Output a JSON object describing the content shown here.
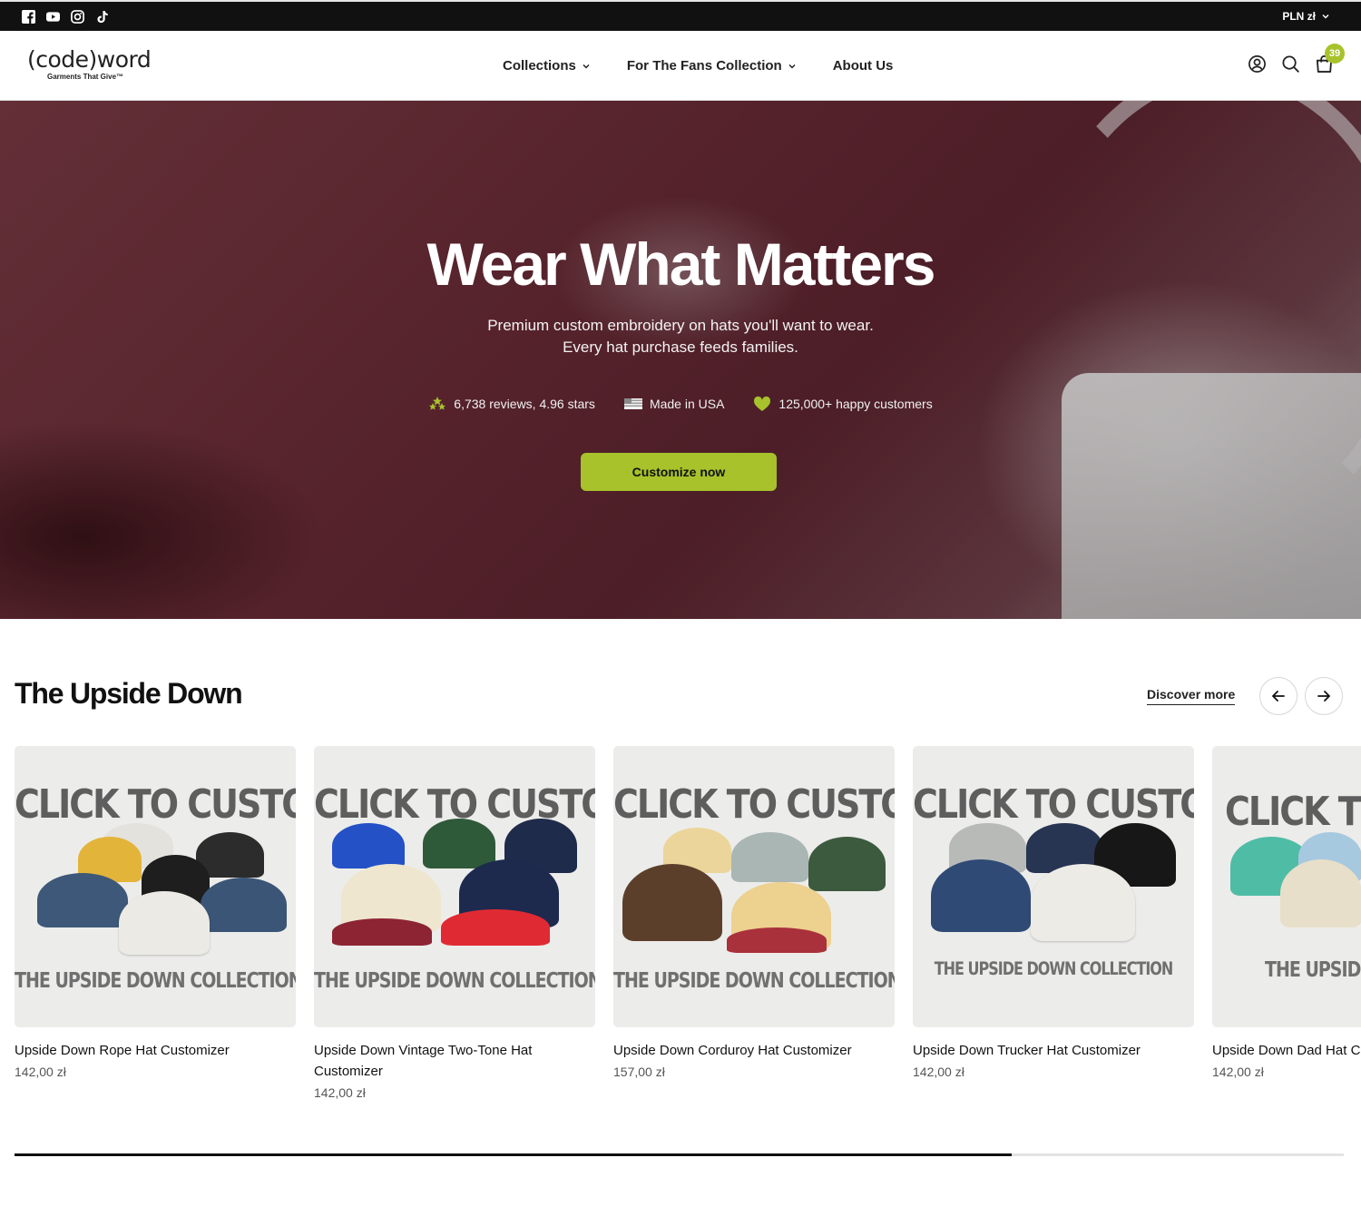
{
  "topbar": {
    "icons": [
      "facebook-icon",
      "youtube-icon",
      "instagram-icon",
      "tiktok-icon"
    ],
    "currency": "PLN zł"
  },
  "header": {
    "logo": {
      "main": "(code)word",
      "tagline": "Garments That Give™"
    },
    "nav": [
      {
        "label": "Collections",
        "dropdown": true
      },
      {
        "label": "For The Fans Collection",
        "dropdown": true
      },
      {
        "label": "About Us",
        "dropdown": false
      }
    ],
    "cart_count": "39"
  },
  "hero": {
    "title": "Wear What Matters",
    "subtitle_line1": "Premium custom embroidery on hats you'll want to wear.",
    "subtitle_line2": "Every hat purchase feeds families.",
    "badges": [
      {
        "icon": "stars-icon",
        "text": "6,738 reviews, 4.96 stars"
      },
      {
        "icon": "us-flag-icon",
        "text": "Made in USA"
      },
      {
        "icon": "heart-icon",
        "text": "125,000+ happy customers"
      }
    ],
    "cta": "Customize now"
  },
  "section": {
    "title": "The Upside Down",
    "discover": "Discover more"
  },
  "products": [
    {
      "name": "Upside Down Rope Hat Customizer",
      "price": "142,00 zł",
      "image_head": "CLICK TO CUSTOMIZE",
      "image_foot": "THE UPSIDE DOWN COLLECTION"
    },
    {
      "name": "Upside Down Vintage Two-Tone Hat Customizer",
      "price": "142,00 zł",
      "image_head": "CLICK TO CUSTOMIZE",
      "image_foot": "THE UPSIDE DOWN COLLECTION"
    },
    {
      "name": "Upside Down Corduroy Hat Customizer",
      "price": "157,00 zł",
      "image_head": "CLICK TO CUSTOMIZE",
      "image_foot": "THE UPSIDE DOWN COLLECTION"
    },
    {
      "name": "Upside Down Trucker Hat Customizer",
      "price": "142,00 zł",
      "image_head": "CLICK TO CUSTOMIZE",
      "image_foot": "THE UPSIDE DOWN COLLECTION"
    },
    {
      "name": "Upside Down Dad Hat Cu",
      "price": "142,00 zł",
      "image_head": "CLICK TO CU",
      "image_foot": "THE UPSIDE DOW"
    }
  ],
  "carousel": {
    "scroll_progress": 0.75
  },
  "colors": {
    "accent": "#a7c22b",
    "topbar": "#111111"
  }
}
